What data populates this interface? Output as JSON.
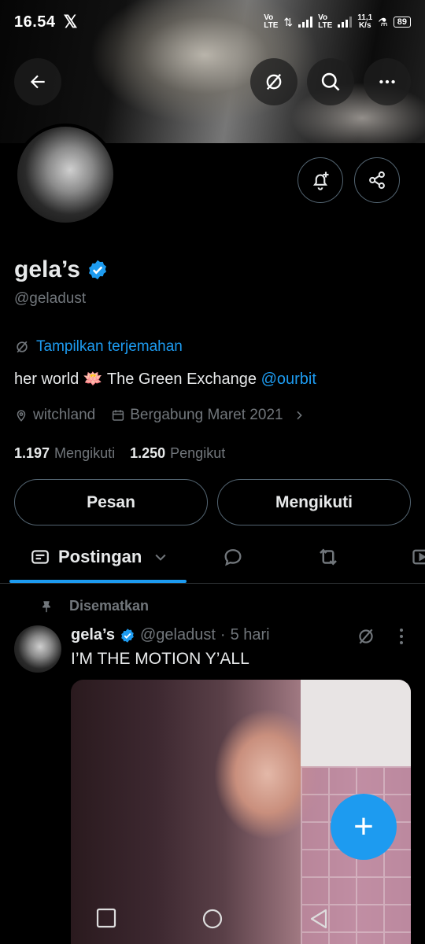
{
  "status_bar": {
    "time": "16.54",
    "app_logo": "𝕏",
    "net_speed_value": "11,1",
    "net_speed_unit": "K/s",
    "battery": "89"
  },
  "header": {
    "back_icon": "arrow-left",
    "translate_icon": "translate",
    "search_icon": "search",
    "more_icon": "more-horizontal"
  },
  "profile": {
    "display_name": "gela’s",
    "handle": "@geladust",
    "translate_link": "Tampilkan terjemahan",
    "bio_text": "her world 🪷 The Green Exchange ",
    "bio_mention": "@ourbit",
    "location": "witchland",
    "joined": "Bergabung Maret 2021",
    "following_count": "1.197",
    "following_label": "Mengikuti",
    "followers_count": "1.250",
    "followers_label": "Pengikut",
    "message_button": "Pesan",
    "following_button": "Mengikuti"
  },
  "tabs": {
    "active_label": "Postingan"
  },
  "post": {
    "pinned_label": "Disematkan",
    "author_name": "gela’s",
    "author_handle": "@geladust",
    "separator": "·",
    "time": "5 hari",
    "text": "I’M THE MOTION Y’ALL"
  },
  "fab": {
    "label": "+"
  },
  "colors": {
    "accent": "#1d9bf0",
    "background": "#000000",
    "muted": "#71767b",
    "border": "#536471"
  }
}
